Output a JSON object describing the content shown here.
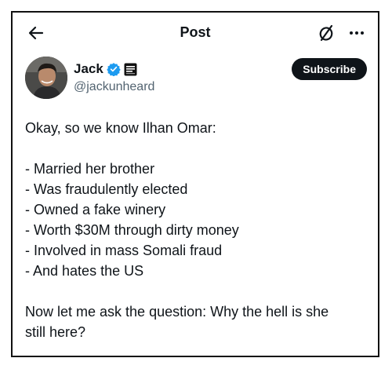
{
  "header": {
    "title": "Post",
    "back_icon": "arrow-left-icon",
    "grok_icon": "grok-slash-circle-icon",
    "more_icon": "ellipsis-icon"
  },
  "author": {
    "display_name": "Jack",
    "handle": "@jackunheard",
    "verified_color": "#1d9bf0",
    "subscribe_label": "Subscribe"
  },
  "post": {
    "lines": [
      "Okay, so we know Ilhan Omar:",
      "",
      "- Married her brother",
      "- Was fraudulently elected",
      "- Owned a fake winery",
      "- Worth $30M through dirty money",
      "- Involved in mass Somali fraud",
      "- And hates the US",
      "",
      "Now let me ask the question: Why the hell is she",
      "still here?"
    ]
  }
}
